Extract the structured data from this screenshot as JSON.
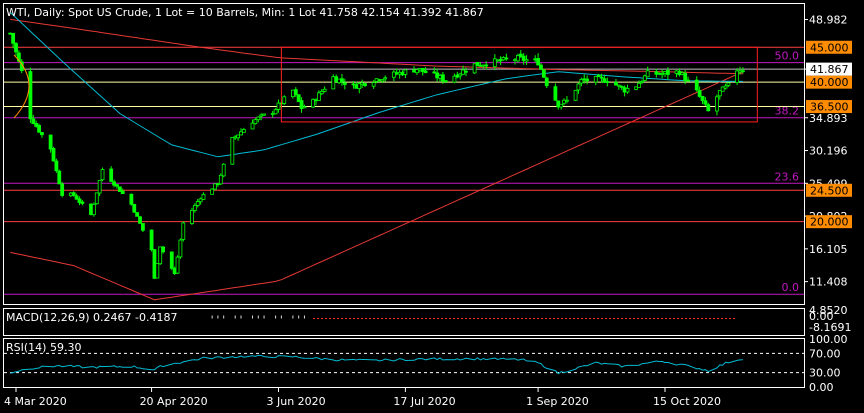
{
  "header": {
    "title": "WTI, Daily:  Spot US Crude, 1 Lot = 10 Barrels, Min: 1 Lot  41.758 42.154 41.392 41.867"
  },
  "colors": {
    "background": "#000000",
    "frame": "#ffffff",
    "bull_candle": "#00ff00",
    "bear_candle": "#00ff00",
    "ma_fast": "#00bcd4",
    "ma_slow": "#e53935",
    "fib_line": "#c018c0",
    "fib_label": "#c018c0",
    "level_line": "#ff4040",
    "level_box": "#ff8c00",
    "current_line": "#ffffff",
    "rect": "#ff2020",
    "macd_hist": "#dcdcdc",
    "macd_signal": "#ff3030",
    "rsi_line": "#00bcd4",
    "rsi_band": "#ffffff",
    "arc": "#ff8c00"
  },
  "chart_data": [
    {
      "type": "candlestick",
      "title": "WTI, Daily:  Spot US Crude, 1 Lot = 10 Barrels, Min: 1 Lot  41.758 42.154 41.392 41.867",
      "ylim": [
        8.2,
        51.2
      ],
      "y_ticks": [
        "48.982",
        "41.867",
        "34.893",
        "30.196",
        "25.499",
        "20.802",
        "16.105",
        "11.408",
        "6.711"
      ],
      "x_ticks": [
        "4 Mar 2020",
        "20 Apr 2020",
        "3 Jun 2020",
        "17 Jul 2020",
        "1 Sep 2020",
        "15 Oct 2020"
      ],
      "price_knots": [
        {
          "date": "2020-03-02",
          "price": 47.0
        },
        {
          "date": "2020-03-06",
          "price": 41.5
        },
        {
          "date": "2020-03-09",
          "price": 35.0
        },
        {
          "date": "2020-03-16",
          "price": 30.5
        },
        {
          "date": "2020-03-20",
          "price": 24.0
        },
        {
          "date": "2020-03-24",
          "price": 23.8
        },
        {
          "date": "2020-03-30",
          "price": 21.0
        },
        {
          "date": "2020-04-03",
          "price": 27.5
        },
        {
          "date": "2020-04-08",
          "price": 25.0
        },
        {
          "date": "2020-04-13",
          "price": 22.5
        },
        {
          "date": "2020-04-16",
          "price": 19.7
        },
        {
          "date": "2020-04-20",
          "price": 16.0
        },
        {
          "date": "2020-04-21",
          "price": 11.8
        },
        {
          "date": "2020-04-23",
          "price": 16.5
        },
        {
          "date": "2020-04-28",
          "price": 12.5
        },
        {
          "date": "2020-05-01",
          "price": 19.8
        },
        {
          "date": "2020-05-07",
          "price": 23.5
        },
        {
          "date": "2020-05-13",
          "price": 25.5
        },
        {
          "date": "2020-05-18",
          "price": 31.8
        },
        {
          "date": "2020-05-25",
          "price": 34.4
        },
        {
          "date": "2020-06-01",
          "price": 35.8
        },
        {
          "date": "2020-06-08",
          "price": 38.8
        },
        {
          "date": "2020-06-11",
          "price": 36.3
        },
        {
          "date": "2020-06-15",
          "price": 37.2
        },
        {
          "date": "2020-06-22",
          "price": 40.7
        },
        {
          "date": "2020-06-29",
          "price": 39.4
        },
        {
          "date": "2020-07-08",
          "price": 40.6
        },
        {
          "date": "2020-07-21",
          "price": 41.9
        },
        {
          "date": "2020-07-31",
          "price": 40.3
        },
        {
          "date": "2020-08-10",
          "price": 42.5
        },
        {
          "date": "2020-08-25",
          "price": 43.4
        },
        {
          "date": "2020-09-01",
          "price": 42.9
        },
        {
          "date": "2020-09-04",
          "price": 39.8
        },
        {
          "date": "2020-09-08",
          "price": 36.8
        },
        {
          "date": "2020-09-11",
          "price": 37.3
        },
        {
          "date": "2020-09-16",
          "price": 40.2
        },
        {
          "date": "2020-09-21",
          "price": 40.4
        },
        {
          "date": "2020-09-25",
          "price": 40.3
        },
        {
          "date": "2020-10-01",
          "price": 38.9
        },
        {
          "date": "2020-10-05",
          "price": 39.5
        },
        {
          "date": "2020-10-09",
          "price": 41.2
        },
        {
          "date": "2020-10-14",
          "price": 41.2
        },
        {
          "date": "2020-10-20",
          "price": 41.5
        },
        {
          "date": "2020-10-26",
          "price": 38.6
        },
        {
          "date": "2020-10-30",
          "price": 35.8
        },
        {
          "date": "2020-11-03",
          "price": 38.6
        },
        {
          "date": "2020-11-06",
          "price": 39.5
        },
        {
          "date": "2020-11-09",
          "price": 41.8
        },
        {
          "date": "2020-11-11",
          "price": 41.867
        }
      ],
      "ma_fast_knots": [
        {
          "date": "2020-03-02",
          "price": 50.0
        },
        {
          "date": "2020-03-20",
          "price": 43.0
        },
        {
          "date": "2020-04-09",
          "price": 35.5
        },
        {
          "date": "2020-04-27",
          "price": 31.0
        },
        {
          "date": "2020-05-13",
          "price": 29.3
        },
        {
          "date": "2020-05-29",
          "price": 30.3
        },
        {
          "date": "2020-06-16",
          "price": 32.5
        },
        {
          "date": "2020-07-09",
          "price": 35.8
        },
        {
          "date": "2020-07-28",
          "price": 38.2
        },
        {
          "date": "2020-08-21",
          "price": 40.5
        },
        {
          "date": "2020-09-08",
          "price": 41.5
        },
        {
          "date": "2020-09-29",
          "price": 40.8
        },
        {
          "date": "2020-10-22",
          "price": 40.2
        },
        {
          "date": "2020-11-11",
          "price": 40.1
        }
      ],
      "ma_slow_knots": [
        {
          "date": "2020-03-02",
          "price": 15.6
        },
        {
          "date": "2020-03-24",
          "price": 13.7
        },
        {
          "date": "2020-04-21",
          "price": 8.8
        },
        {
          "date": "2020-06-03",
          "price": 11.5
        },
        {
          "date": "2020-11-11",
          "price": 41.5
        }
      ],
      "ma_slow_top_knots": [
        {
          "date": "2020-03-02",
          "price": 49.0
        },
        {
          "date": "2020-03-24",
          "price": 47.7
        },
        {
          "date": "2020-05-07",
          "price": 45.0
        },
        {
          "date": "2020-06-03",
          "price": 43.5
        },
        {
          "date": "2020-07-28",
          "price": 42.3
        },
        {
          "date": "2020-09-08",
          "price": 41.8
        },
        {
          "date": "2020-10-14",
          "price": 41.5
        },
        {
          "date": "2020-11-11",
          "price": 41.2
        }
      ],
      "fibonacci": [
        {
          "label": "50.0",
          "price": 42.8
        },
        {
          "label": "38.2",
          "price": 34.9
        },
        {
          "label": "23.6",
          "price": 25.499
        },
        {
          "label": "0.0",
          "price": 9.6
        }
      ],
      "levels": [
        {
          "label": "45.000",
          "price": 45.0
        },
        {
          "label": "40.000",
          "price": 40.0
        },
        {
          "label": "36.500",
          "price": 36.5
        },
        {
          "label": "24.500",
          "price": 24.5
        },
        {
          "label": "20.000",
          "price": 20.0
        }
      ],
      "current_price": {
        "label": "41.867",
        "price": 41.867
      },
      "range_box": {
        "start": "2020-06-04",
        "end": "2020-11-16",
        "top": 45.0,
        "bottom": 34.3
      }
    },
    {
      "type": "histogram",
      "title": "MACD(12,26,9) 0.2467 -0.4187",
      "y_ticks": [
        "4.8520",
        "0.00",
        "-8.1691"
      ]
    },
    {
      "type": "line",
      "title": "RSI(14) 59.30",
      "ylim": [
        0,
        100
      ],
      "y_ticks": [
        "100.00",
        "70.00",
        "30.00",
        "0.00"
      ],
      "bands": [
        70,
        30
      ],
      "rsi_knots": [
        {
          "date": "2020-03-02",
          "value": 30
        },
        {
          "date": "2020-03-09",
          "value": 39
        },
        {
          "date": "2020-03-18",
          "value": 44
        },
        {
          "date": "2020-03-30",
          "value": 41
        },
        {
          "date": "2020-04-13",
          "value": 43
        },
        {
          "date": "2020-04-21",
          "value": 36
        },
        {
          "date": "2020-04-24",
          "value": 45
        },
        {
          "date": "2020-05-08",
          "value": 60
        },
        {
          "date": "2020-05-22",
          "value": 64
        },
        {
          "date": "2020-06-08",
          "value": 63
        },
        {
          "date": "2020-06-22",
          "value": 57
        },
        {
          "date": "2020-07-06",
          "value": 55
        },
        {
          "date": "2020-07-20",
          "value": 58
        },
        {
          "date": "2020-08-10",
          "value": 59
        },
        {
          "date": "2020-08-26",
          "value": 57
        },
        {
          "date": "2020-09-01",
          "value": 50
        },
        {
          "date": "2020-09-08",
          "value": 29
        },
        {
          "date": "2020-09-21",
          "value": 50
        },
        {
          "date": "2020-10-01",
          "value": 43
        },
        {
          "date": "2020-10-14",
          "value": 54
        },
        {
          "date": "2020-10-26",
          "value": 40
        },
        {
          "date": "2020-10-30",
          "value": 34
        },
        {
          "date": "2020-11-06",
          "value": 52
        },
        {
          "date": "2020-11-11",
          "value": 59.3
        }
      ]
    }
  ]
}
